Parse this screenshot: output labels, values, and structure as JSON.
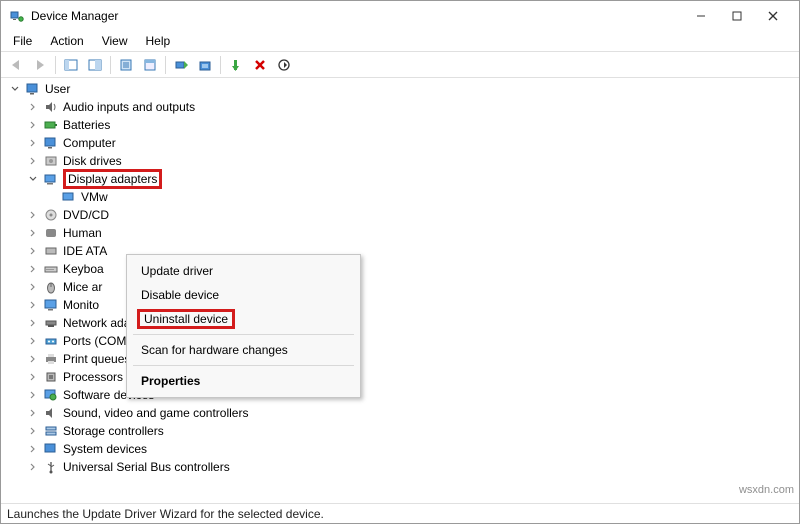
{
  "window": {
    "title": "Device Manager"
  },
  "menubar": [
    "File",
    "Action",
    "View",
    "Help"
  ],
  "tree": {
    "root": "User",
    "items": [
      "Audio inputs and outputs",
      "Batteries",
      "Computer",
      "Disk drives",
      "Display adapters",
      "VMw",
      "DVD/CD",
      "Human",
      "IDE ATA",
      "Keyboa",
      "Mice ar",
      "Monito",
      "Network adapters",
      "Ports (COM & LPT)",
      "Print queues",
      "Processors",
      "Software devices",
      "Sound, video and game controllers",
      "Storage controllers",
      "System devices",
      "Universal Serial Bus controllers"
    ]
  },
  "context_menu": {
    "items": [
      "Update driver",
      "Disable device",
      "Uninstall device",
      "Scan for hardware changes",
      "Properties"
    ]
  },
  "statusbar": "Launches the Update Driver Wizard for the selected device.",
  "watermark": "wsxdn.com"
}
